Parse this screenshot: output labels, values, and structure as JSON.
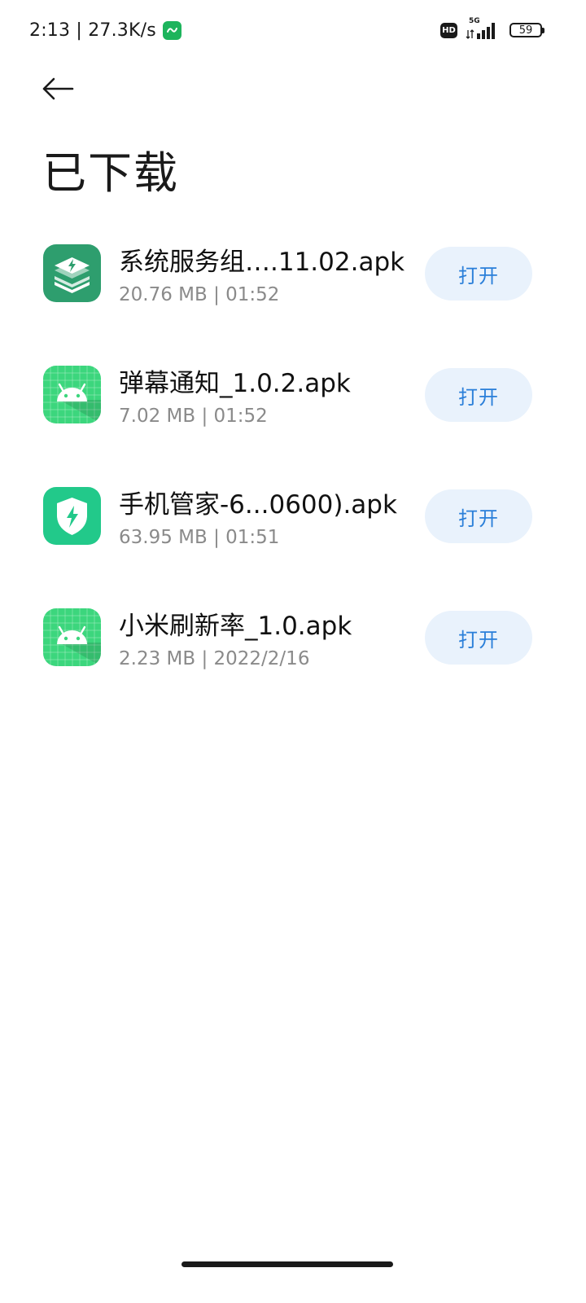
{
  "status_bar": {
    "time_speed": "2:13 | 27.3K/s",
    "hd_label": "HD",
    "network_label": "5G",
    "battery_level": "59"
  },
  "header": {
    "title": "已下载"
  },
  "downloads": [
    {
      "name": "系统服务组….11.02.apk",
      "meta": "20.76 MB | 01:52",
      "icon": "layers-bolt-icon",
      "action_label": "打开"
    },
    {
      "name": "弹幕通知_1.0.2.apk",
      "meta": "7.02 MB | 01:52",
      "icon": "android-icon",
      "action_label": "打开"
    },
    {
      "name": "手机管家-6...0600).apk",
      "meta": "63.95 MB | 01:51",
      "icon": "shield-bolt-icon",
      "action_label": "打开"
    },
    {
      "name": "小米刷新率_1.0.apk",
      "meta": "2.23 MB | 2022/2/16",
      "icon": "android-icon",
      "action_label": "打开"
    }
  ],
  "colors": {
    "accent": "#2a7fd9",
    "button_bg": "#e9f2fc",
    "icon_green_dark": "#2e9e6e",
    "icon_green_light": "#3cd67d",
    "icon_teal": "#22c98a"
  }
}
